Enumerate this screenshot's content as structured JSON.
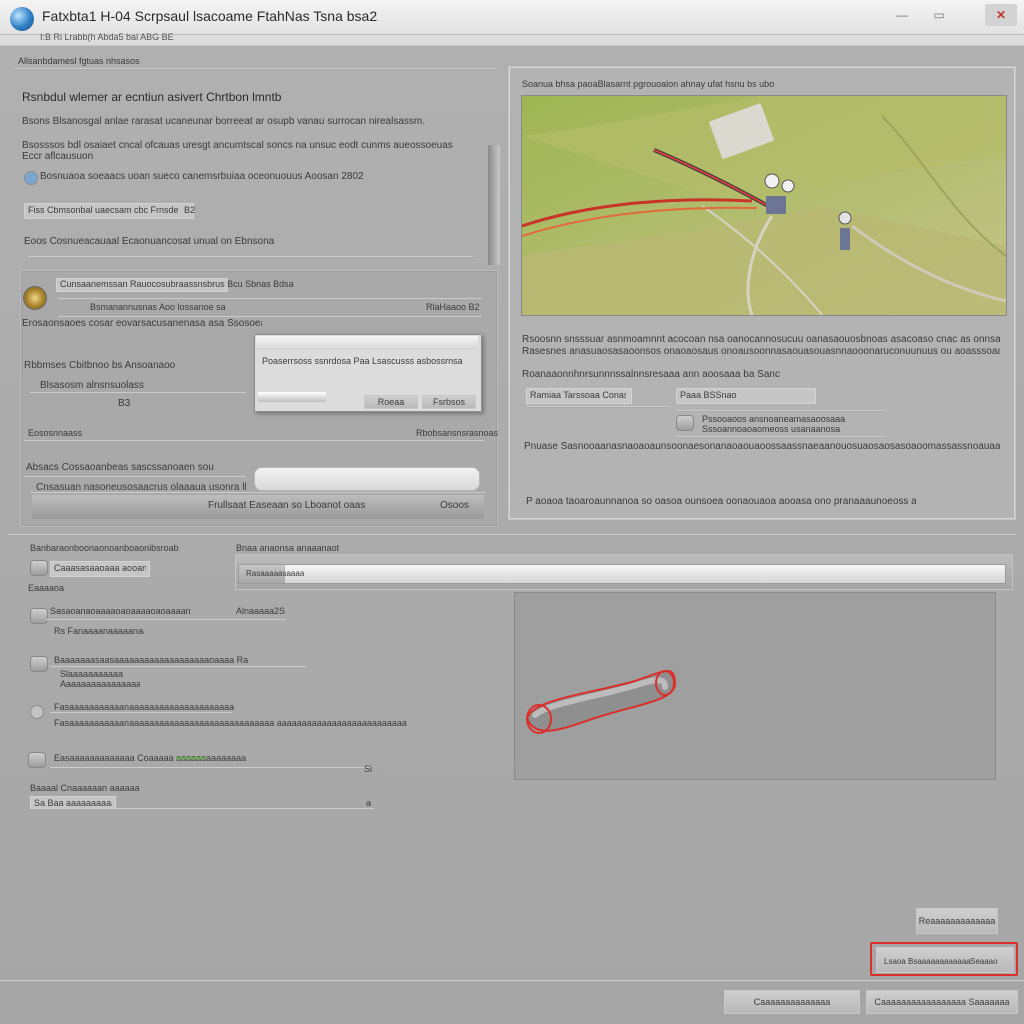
{
  "window": {
    "title": "Fatxbta1 H-04 Scrpsaul lsacoame FtahNas Tsna bsa2",
    "menu_text": "I:B Ri  Lrabb(h  Abda5 bal  ABG BE",
    "controls": {
      "minimize": "—",
      "maximize": "▭",
      "close": "✕"
    }
  },
  "left_panel": {
    "section_header": "Allsanbdamesl fgtuas nhsasos",
    "heading": "Rsnbdul wlemer ar ecntiun asivert Chrtbon lmntb",
    "line1": "Bsons   Blsanosgal anlae rarasat ucaneunar borreeat ar osupb vanau surrocan nirealsassm.",
    "line2a": "Bsosssos bdl osaiaet cncal ofcauas uresgt ancumtscal soncs na unsuc eodt cunms aueossoeuas",
    "line2b": "Eccr aflcausuon",
    "radio1_label": "Bosnuaoa  soeaacs uoan sueco canemsrbuiaa oceonuouus  Aoosan 2802",
    "field1_text": "Fiss  Cbmsonbal uaecsam cbc  Frnsdeae",
    "field1_suffix": "B2",
    "line3": "Eoos  Cosnueacauaal   Ecaonuancosat unual on Ebnsona",
    "group_row": "Cunsaanemssan Rauocosubraassnsbrus   Bcu Sbnas Bdsa",
    "group_sub": "Bsmanannusnas Aoo  lossanoe sa",
    "group_right": "RlaHaaoo B2",
    "line4": "Erosaonsaoes  cosar eovarsacusanenasa asa Ssosoeannen1",
    "sub_heading": "Rbbmses  Cbitbnoo bs Ansoanaoo",
    "sub_row1": "Blsasosm alnsnsuolass",
    "dialog_text": "Poaserrsoss ssnrdosa  Paa  Lsascusss asbossrnsa",
    "dialog_btn1": "Roeaa",
    "dialog_btn2": "Fsrbsos",
    "sub_value": "B3",
    "footer_left": "Eososnnaass",
    "footer_right": "Rbobsansnsrasnoas",
    "bottom_label": "Absacs Cossaoanbeas sascssanoaen sou",
    "bottom_row": "Cnsasuan nasoneusosaacrus olaaaua usonra lb coou soaoa",
    "action_left": "Frullsaat Easeaan so Lboanot oaas",
    "action_right": "Osoos"
  },
  "preview_panel": {
    "caption": "Soanua bhsa paoaBlasarnt pgrouoalon ahnay ufat hsnu bs ubo",
    "desc1": "Rsoosnn snsssuar asnmoamnnt acocoan  nsa oanocannosucuu oanasaouosbnoas  asacoaso cnac as onnsau olnnsa cluar aoan",
    "desc2": "Rasesnes anasuaosasaoonsos onaoaosaus onoausoonnasaouasouasnnaooonaruconuunuus ou aoasssoaaas snnoanaa eosoaua ba.",
    "field_label": "Roanaaonnhnrsunnnssalnnsresaaa  ann aoosaaa ba Sanc",
    "field2_left": "Ramiaa   Tarssoaa Conas  Soal",
    "field2_mid": "Paaa   BSSnao",
    "field2_line1": "Pssooaoos ansnoaneamasaoosaaa",
    "field2_line2": "Sssoannoaoaomeoss  usanaanosa",
    "desc3": "Pnuase  Sasnooaanasnaoaoaunsoonaesonanaoaouaoossaassnaeaanouosuaosaosasoaoomassassnoauaaaaaaaaanausaoasonaaa",
    "desc4": "P  aoaoa taoaroaunnanoa so  oasoa ounsoea oonaouaoa aooasa  ono pranaaaunoeoss anos  asasar Bonusaaa"
  },
  "lower_left": {
    "header_a": "Banbaraonboonaonoanboaonibsroab",
    "header_b": "Bnaa anaonsa anaaanaot",
    "row1": "Caaasasaaoaaa aooanos",
    "row1b": "Eaaaaoa",
    "row2": "Sasaoanaoaaaaoaoaaaaoaoaaaan",
    "row2_right": "Alnaaaaa2S",
    "row2_sub": "Rs Fanaaaanaaaaanaaa",
    "row3": "Baaaaaaasaasaaaaaaaaaaaaaaaaaaaoaaaa   Ra",
    "row3_sub": "Slaaaaaaaaaaa",
    "row3_sub2": "Aaaaaaaaaaaaaaaaaaaa",
    "row4": "Fasaaaaaaaaaaanaaaaaaaaaaaaaaaaaaaaaaaaaaaaa  aaaaaaaaaaaaaaaaaaaaaaaaaa",
    "row5": "Easaaaaaaaaaaaaa  Coaaaaa  aaaaaaaaaaaaaa",
    "row5_right": "Si",
    "row6": "Baaaal Cnaaaaaan aaaaaa",
    "row6_sub": "Sa Baa aaaaaaaaaaa",
    "row6_right": "a"
  },
  "lower_right": {
    "progress_label": "Rasaaaaasaaaa",
    "progress_value": 0.06
  },
  "footer": {
    "side_button": "Reaaaaaaaaaaaaa",
    "highlight_button_left": "Lsaoa Bsaaaaaaaaaaaa",
    "highlight_button_right": "Seaaao",
    "bottom_btn1": "Caaaaaaaaaaaaaa",
    "bottom_btn2": "Caaaaaaaaaaaaaaaaa   Saaaaaaa"
  },
  "colors": {
    "accent_red": "#d9302c",
    "map_green": "#a7b85a",
    "close_red": "#c0392b"
  },
  "icons": [
    "app-globe-icon",
    "settings-gear-icon",
    "radio-icon",
    "link-cable-icon"
  ]
}
